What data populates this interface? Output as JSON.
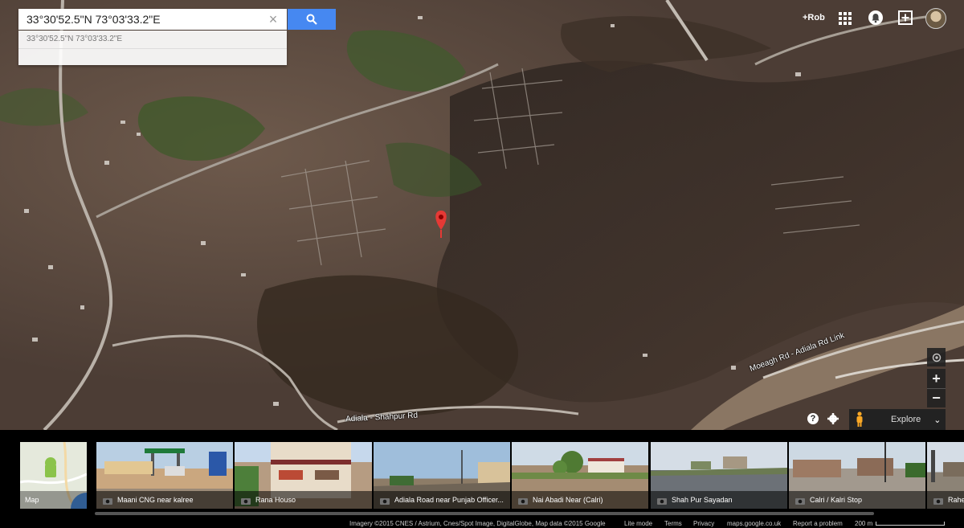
{
  "search": {
    "value": "33°30'52.5\"N 73°03'33.2\"E",
    "suggestion": "33°30'52.5\"N 73°03'33.2\"E"
  },
  "account": {
    "user_label": "+Rob"
  },
  "map": {
    "road_labels": [
      "Moeagh Rd - Adiala Rd Link",
      "Adiala - Shahpur Rd"
    ],
    "explore_label": "Explore"
  },
  "cards": [
    {
      "caption": "Map"
    },
    {
      "caption": "Maani CNG near kalree"
    },
    {
      "caption": "Rana Houso"
    },
    {
      "caption": "Adiala Road near Punjab Officer..."
    },
    {
      "caption": "Nai Abadi Near (Calri)"
    },
    {
      "caption": "Shah Pur Sayadan"
    },
    {
      "caption": "Calri / Kalri Stop"
    },
    {
      "caption": "Rahe"
    }
  ],
  "footer": {
    "attribution": "Imagery ©2015 CNES / Astrium, Cnes/Spot Image, DigitalGlobe, Map data ©2015 Google",
    "lite_mode": "Lite mode",
    "terms": "Terms",
    "privacy": "Privacy",
    "domain": "maps.google.co.uk",
    "report": "Report a problem",
    "scale": "200 m"
  },
  "colors": {
    "search_button": "#4688f1",
    "marker": "#e53935",
    "terrain_dark": "#3a2f29",
    "terrain_light": "#6d5546",
    "river": "#8a7663"
  }
}
